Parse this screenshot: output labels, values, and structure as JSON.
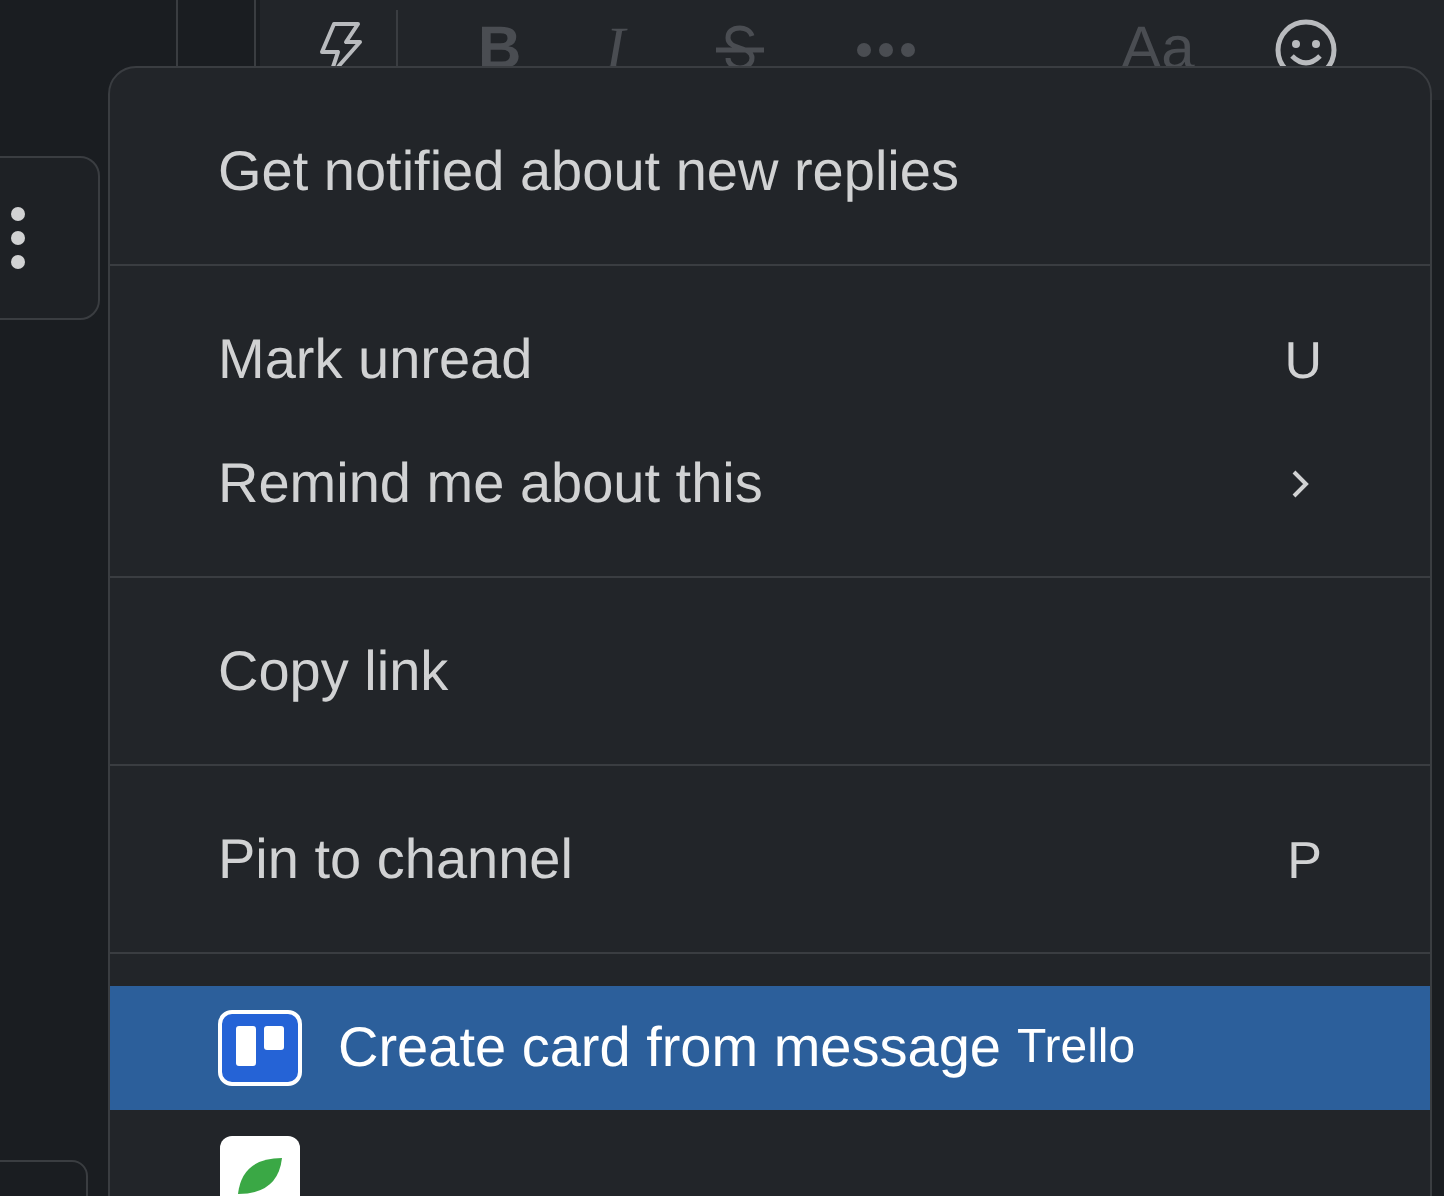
{
  "toolbar": {
    "bold": "B",
    "italic": "I",
    "text_style": "Aa"
  },
  "menu": {
    "sections": [
      [
        {
          "kind": "item",
          "label": "Get notified about new replies",
          "selected": false
        }
      ],
      [
        {
          "kind": "item",
          "label": "Mark unread",
          "shortcut": "U",
          "selected": false
        },
        {
          "kind": "submenu",
          "label": "Remind me about this",
          "selected": false
        }
      ],
      [
        {
          "kind": "item",
          "label": "Copy link",
          "selected": false
        }
      ],
      [
        {
          "kind": "item",
          "label": "Pin to channel",
          "shortcut": "P",
          "selected": false
        }
      ],
      [
        {
          "kind": "app",
          "label": "Create card from message",
          "app_name": "Trello",
          "color": "#2563d6",
          "selected": true
        },
        {
          "kind": "app",
          "color": "#ffffff",
          "selected": false
        }
      ]
    ]
  }
}
